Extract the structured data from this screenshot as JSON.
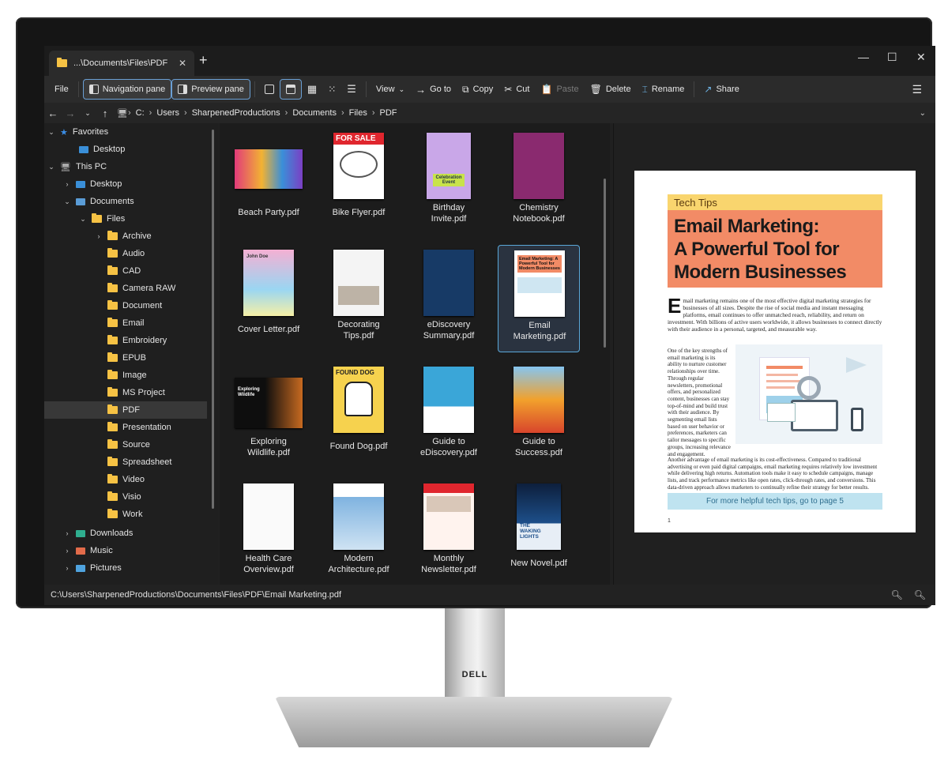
{
  "tab": {
    "title": "...\\Documents\\Files\\PDF",
    "close": "✕",
    "new": "+"
  },
  "window": {
    "minimize": "—",
    "maximize": "☐",
    "close": "✕"
  },
  "toolbar": {
    "file": "File",
    "navigation_pane": "Navigation pane",
    "preview_pane": "Preview pane",
    "view": "View",
    "goto": "Go to",
    "copy": "Copy",
    "cut": "Cut",
    "paste": "Paste",
    "delete": "Delete",
    "rename": "Rename",
    "share": "Share",
    "menu": "☰"
  },
  "address": {
    "root": "C:",
    "crumbs": [
      "Users",
      "SharpenedProductions",
      "Documents",
      "Files",
      "PDF"
    ]
  },
  "tree": {
    "favorites": "Favorites",
    "fav_desktop": "Desktop",
    "this_pc": "This PC",
    "desktop": "Desktop",
    "documents": "Documents",
    "files": "Files",
    "folders": [
      "Archive",
      "Audio",
      "CAD",
      "Camera RAW",
      "Document",
      "Email",
      "Embroidery",
      "EPUB",
      "Image",
      "MS Project",
      "PDF",
      "Presentation",
      "Source",
      "Spreadsheet",
      "Video",
      "Visio",
      "Work"
    ],
    "downloads": "Downloads",
    "music": "Music",
    "pictures": "Pictures"
  },
  "files": [
    {
      "line1": "Beach Party.pdf",
      "line2": ""
    },
    {
      "line1": "Bike Flyer.pdf",
      "line2": ""
    },
    {
      "line1": "Birthday",
      "line2": "Invite.pdf"
    },
    {
      "line1": "Chemistry",
      "line2": "Notebook.pdf"
    },
    {
      "line1": "Cover Letter.pdf",
      "line2": ""
    },
    {
      "line1": "Decorating",
      "line2": "Tips.pdf"
    },
    {
      "line1": "eDiscovery",
      "line2": "Summary.pdf"
    },
    {
      "line1": "Email",
      "line2": "Marketing.pdf"
    },
    {
      "line1": "Exploring",
      "line2": "Wildlife.pdf"
    },
    {
      "line1": "Found Dog.pdf",
      "line2": ""
    },
    {
      "line1": "Guide to",
      "line2": "eDiscovery.pdf"
    },
    {
      "line1": "Guide to",
      "line2": "Success.pdf"
    },
    {
      "line1": "Health Care",
      "line2": "Overview.pdf"
    },
    {
      "line1": "Modern",
      "line2": "Architecture.pdf"
    },
    {
      "line1": "Monthly",
      "line2": "Newsletter.pdf"
    },
    {
      "line1": "New Novel.pdf",
      "line2": ""
    }
  ],
  "thumb_text": {
    "for_sale": "FOR SALE",
    "celebration": "Celebration Event",
    "found_dog": "FOUND DOG",
    "email_marketing": "Email Marketing: A Powerful Tool for Modern Businesses",
    "exploring": "Exploring Wildlife",
    "cover": "John Doe",
    "the_waking": "THE WAKING LIGHTS"
  },
  "preview": {
    "kicker": "Tech Tips",
    "title1": "Email Marketing:",
    "title2": "A Powerful Tool for",
    "title3": "Modern Businesses",
    "dropcap": "E",
    "p1": "mail marketing remains one of the most effective digital marketing strategies for businesses of all sizes. Despite the rise of social media and instant messaging platforms, email continues to offer unmatched reach, reliability, and return on investment. With billions of active users worldwide, it allows businesses to connect directly with their audience in a personal, targeted, and measurable way.",
    "p2": "One of the key strengths of email marketing is its ability to nurture customer relationships over time. Through regular newsletters, promotional offers, and personalized content, businesses can stay top-of-mind and build trust with their audience. By segmenting email lists based on user behavior or preferences, marketers can tailor messages to specific groups, increasing relevance and engagement.",
    "p3": "Another advantage of email marketing is its cost-effectiveness. Compared to traditional advertising or even paid digital campaigns, email marketing requires relatively low investment while delivering high returns. Automation tools make it easy to schedule campaigns, manage lists, and track performance metrics like open rates, click-through rates, and conversions. This data-driven approach allows marketers to continually refine their strategy for better results.",
    "footer": "For more helpful tech tips, go to page 5",
    "page_no": "1"
  },
  "status": {
    "path": "C:\\Users\\SharpenedProductions\\Documents\\Files\\PDF\\Email Marketing.pdf"
  },
  "monitor": {
    "brand": "DELL"
  },
  "colors": {
    "accent": "#5aa7d8",
    "folder": "#f6c244",
    "kicker_bg": "#f9d56e",
    "title_bg": "#f28b66",
    "footer_bg": "#bfe3f0"
  }
}
